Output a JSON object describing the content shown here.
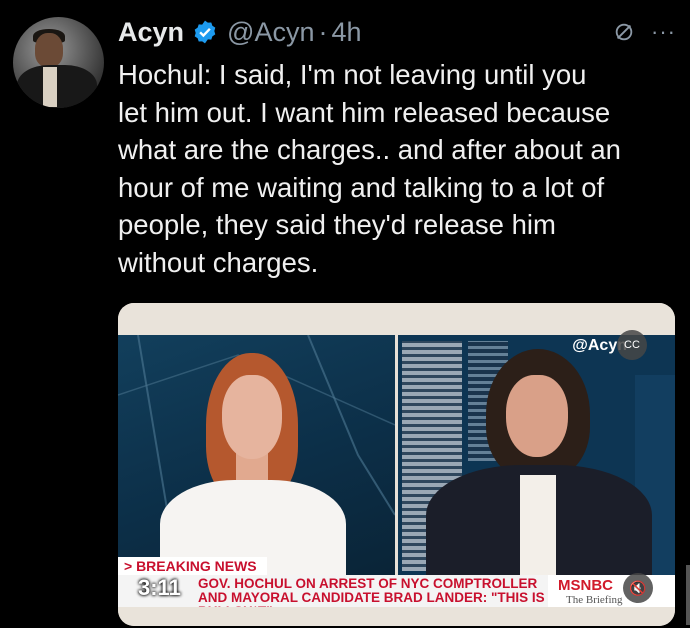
{
  "tweet": {
    "author_name": "Acyn",
    "handle": "@Acyn",
    "separator": "·",
    "time": "4h",
    "text": "Hochul: I said, I'm not leaving until you\nlet him out. I want him released because\nwhat are the charges.. and after about an\nhour of me waiting and talking to a lot of\npeople, they said they'd release him\nwithout charges.",
    "more_label": "···"
  },
  "video": {
    "watermark": "@Acyn",
    "breaking_label": "> BREAKING NEWS",
    "chyron_line1": "GOV. HOCHUL ON ARREST OF NYC COMPTROLLER",
    "chyron_line2": "AND MAYORAL CANDIDATE BRAD LANDER: \"THIS IS BULLSH*T\"",
    "network": "MSNBC",
    "show_name": "The Briefing",
    "timer": "3:11",
    "cc_label": "CC"
  },
  "colors": {
    "background": "#000000",
    "text": "#e7e9ea",
    "muted": "#8b98a5",
    "verified": "#1d9bf0",
    "chyron_red": "#c8102e"
  }
}
